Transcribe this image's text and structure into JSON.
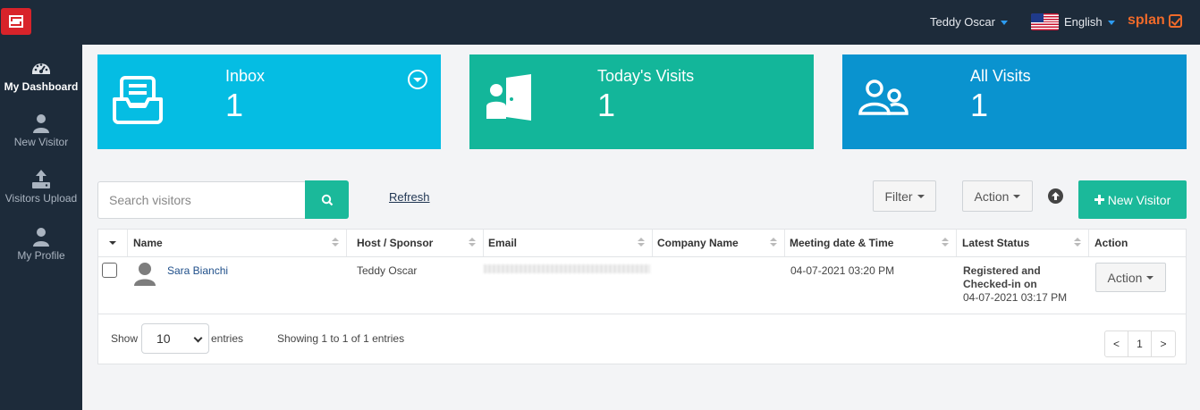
{
  "topbar": {
    "user_name": "Teddy Oscar",
    "language": "English",
    "brand": "splan"
  },
  "sidebar": {
    "items": [
      {
        "label": "My Dashboard",
        "icon": "dashboard-icon",
        "active": true
      },
      {
        "label": "New Visitor",
        "icon": "user-icon"
      },
      {
        "label": "Visitors Upload",
        "icon": "upload-icon"
      },
      {
        "label": "My Profile",
        "icon": "user-icon"
      }
    ]
  },
  "cards": [
    {
      "title": "Inbox",
      "count": "1",
      "color": "#05bde3",
      "icon": "inbox-icon"
    },
    {
      "title": "Today's Visits",
      "count": "1",
      "color": "#13b69a",
      "icon": "door-person-icon"
    },
    {
      "title": "All Visits",
      "count": "1",
      "color": "#0a93cf",
      "icon": "users-icon"
    }
  ],
  "toolbar": {
    "search_placeholder": "Search visitors",
    "refresh_label": "Refresh",
    "filter_label": "Filter",
    "action_label": "Action",
    "new_visitor_label": "New Visitor"
  },
  "table": {
    "columns": [
      "Name",
      "Host / Sponsor",
      "Email",
      "Company Name",
      "Meeting date & Time",
      "Latest Status",
      "Action"
    ],
    "rows": [
      {
        "name": "Sara Bianchi",
        "host": "Teddy Oscar",
        "email": "",
        "company": "",
        "meeting": "04-07-2021 03:20 PM",
        "status_line1": "Registered and",
        "status_line2": "Checked-in on",
        "status_date": "04-07-2021 03:17 PM",
        "action_label": "Action"
      }
    ]
  },
  "footer": {
    "show_label": "Show",
    "entries_value": "10",
    "entries_label": "entries",
    "showing_info": "Showing 1 to 1 of 1 entries",
    "prev": "<",
    "page": "1",
    "next": ">"
  },
  "colors": {
    "nav_bg": "#1d2b3a",
    "accent_green": "#1bb99a",
    "brand_orange": "#f06a2a"
  }
}
